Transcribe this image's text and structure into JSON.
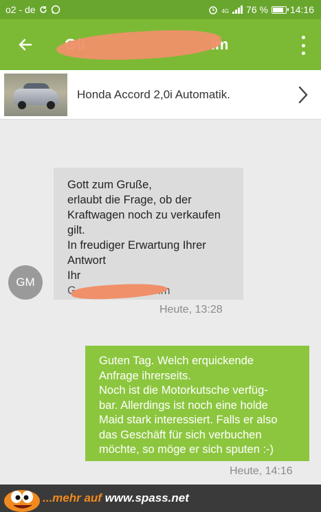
{
  "status_bar": {
    "carrier": "o2 - de",
    "battery": "76 %",
    "time": "14:16",
    "network": "4G"
  },
  "app_bar": {
    "contact_name": "Gü",
    "contact_name_suffix": "im"
  },
  "listing": {
    "title": "Honda Accord 2,0i Automatik."
  },
  "incoming": {
    "avatar_initials": "GM",
    "lines": [
      "Gott zum Gruße,",
      "erlaubt die Frage, ob der",
      "Kraftwagen noch zu verkaufen",
      "gilt.",
      "In freudiger Erwartung Ihrer",
      "Antwort",
      "Ihr"
    ],
    "signature_prefix": "G",
    "signature_suffix": "im",
    "timestamp": "Heute, 13:28"
  },
  "outgoing": {
    "lines": [
      "Guten Tag. Welch erquickende",
      "Anfrage ihrerseits.",
      "Noch ist die Motorkutsche verfüg-",
      "bar. Allerdings ist noch eine holde",
      "Maid stark interessiert. Falls er also",
      "das Geschäft für sich verbuchen",
      "möchte, so möge er sich sputen :-)"
    ],
    "timestamp": "Heute, 14:16"
  },
  "footer": {
    "prefix": "...mehr auf",
    "site": "www.spass.net"
  },
  "colors": {
    "status_bar": "#69a62e",
    "app_bar": "#7cba35",
    "outgoing_bubble": "#8cc63f",
    "incoming_bubble": "#dcdcdc",
    "redaction": "#f0906a"
  }
}
